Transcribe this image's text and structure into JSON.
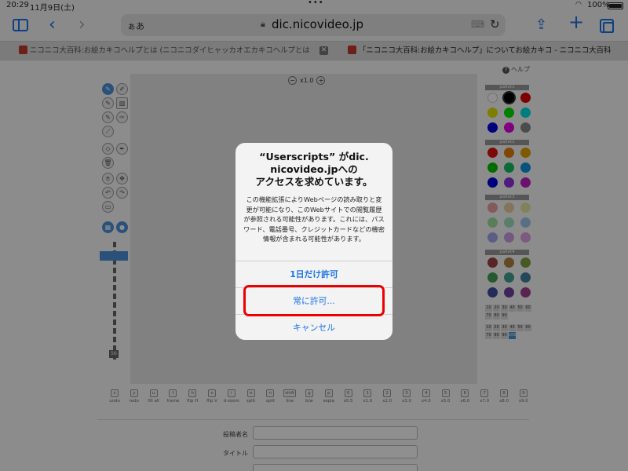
{
  "status_bar": {
    "time": "20:29",
    "date": "11月9日(土)",
    "battery": "100%"
  },
  "toolbar": {
    "aa": "ぁあ",
    "url": "dic.nicovideo.jp"
  },
  "tabs": [
    {
      "label": "ニコニコ大百科:お絵カキコヘルプとは (ニコニコダイヒャッカオエカキコヘルプとは) [単語..."
    },
    {
      "label": "「ニコニコ大百科:お絵カキコヘルプ」についてお絵カキコ - ニコニコ大百科"
    }
  ],
  "page": {
    "help": "ヘルプ",
    "zoom": "x1.0",
    "palettes": [
      {
        "name": "pallet1",
        "colors": [
          "#ffffff",
          "#000000",
          "#e00000",
          "#e0e000",
          "#00e000",
          "#00e0e0",
          "#0000e0",
          "#e000e0",
          "#888888"
        ]
      },
      {
        "name": "pallet2",
        "colors": [
          "#e01010",
          "#e08000",
          "#e0a000",
          "#00c000",
          "#10c060",
          "#1090e0",
          "#0000e0",
          "#9030e0",
          "#c020c0"
        ]
      },
      {
        "name": "pallet3",
        "colors": [
          "#e8a0a0",
          "#e8d0a0",
          "#e8e8a0",
          "#a0e0a0",
          "#a0e0c0",
          "#a0c8e8",
          "#a0a8e8",
          "#c8a0e8",
          "#e0a0e0"
        ]
      },
      {
        "name": "pallet4",
        "colors": [
          "#a04040",
          "#b08040",
          "#80a040",
          "#40a050",
          "#40a090",
          "#4080a0",
          "#4050a0",
          "#7040a0",
          "#a04090"
        ]
      }
    ],
    "numbers_row1": [
      "10",
      "20",
      "30",
      "40",
      "50",
      "60",
      "70",
      "80",
      "90"
    ],
    "numbers_row2": [
      "10",
      "20",
      "30",
      "40",
      "50",
      "60",
      "70",
      "80",
      "90",
      "100"
    ],
    "keys": [
      {
        "key": "z",
        "label": "undo"
      },
      {
        "key": "y",
        "label": "redo"
      },
      {
        "key": "u",
        "label": "fill all"
      },
      {
        "key": "f",
        "label": "frame"
      },
      {
        "key": "h",
        "label": "flip H"
      },
      {
        "key": "v",
        "label": "flip V"
      },
      {
        "key": "i",
        "label": "d-zoom"
      },
      {
        "key": "o",
        "label": "split"
      },
      {
        "key": "n",
        "label": "split"
      },
      {
        "key": "shift",
        "label": "line"
      },
      {
        "key": "g",
        "label": "b/w"
      },
      {
        "key": "p",
        "label": "sepia"
      },
      {
        "key": "0",
        "label": "x0.5"
      },
      {
        "key": "1",
        "label": "x1.0"
      },
      {
        "key": "2",
        "label": "x2.0"
      },
      {
        "key": "3",
        "label": "x3.0"
      },
      {
        "key": "4",
        "label": "x4.0"
      },
      {
        "key": "5",
        "label": "x5.0"
      },
      {
        "key": "6",
        "label": "x6.0"
      },
      {
        "key": "7",
        "label": "x7.0"
      },
      {
        "key": "8",
        "label": "x8.0"
      },
      {
        "key": "9",
        "label": "x9.0"
      }
    ],
    "form": {
      "poster_label": "投稿者名",
      "title_label": "タイトル"
    },
    "size_label": "56"
  },
  "dialog": {
    "title": "“Userscripts” がdic.\nnicovideo.jpへの\nアクセスを求めています。",
    "message": "この機能拡張によりWebページの読み取りと変更が可能になり、このWebサイトでの閲覧履歴が参照される可能性があります。これには、パスワード、電話番号、クレジットカードなどの機密情報が含まれる可能性があります。",
    "allow_once": "1日だけ許可",
    "always_allow": "常に許可...",
    "cancel": "キャンセル"
  }
}
